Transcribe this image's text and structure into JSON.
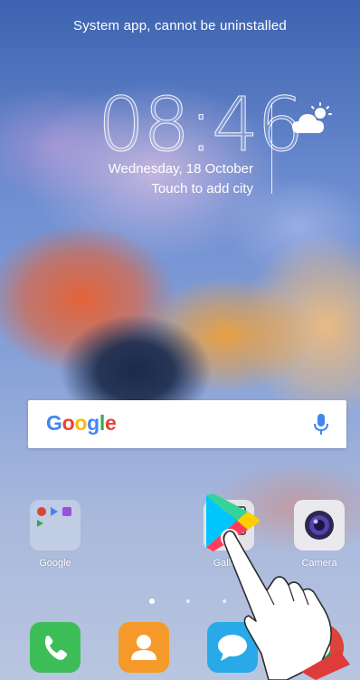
{
  "system_toast": "System app, cannot be uninstalled",
  "clock": {
    "time": "08:46",
    "date": "Wednesday, 18 October",
    "city_hint": "Touch to add city"
  },
  "weather": {
    "icon": "partly-cloudy-icon"
  },
  "search": {
    "logo_text": "Google",
    "logo_colors": [
      "#4285F4",
      "#EA4335",
      "#FBBC05",
      "#4285F4",
      "#34A853",
      "#EA4335"
    ],
    "mic_icon": "microphone-icon"
  },
  "home_apps": [
    {
      "label": "Google",
      "icon": "google-folder-icon"
    },
    {
      "label": "Gallery",
      "icon": "gallery-icon"
    },
    {
      "label": "Camera",
      "icon": "camera-icon"
    }
  ],
  "dragging_app": {
    "icon": "play-store-icon"
  },
  "page_indicator": {
    "pages": 4,
    "active": 1
  },
  "dock": [
    {
      "icon": "phone-icon",
      "color": "#3dbd57"
    },
    {
      "icon": "contacts-icon",
      "color": "#f59a2a"
    },
    {
      "icon": "messaging-icon",
      "color": "#29a9e8"
    },
    {
      "icon": "chrome-icon",
      "color": "#db4437"
    }
  ],
  "gesture": {
    "icon": "hand-pointer-icon"
  }
}
